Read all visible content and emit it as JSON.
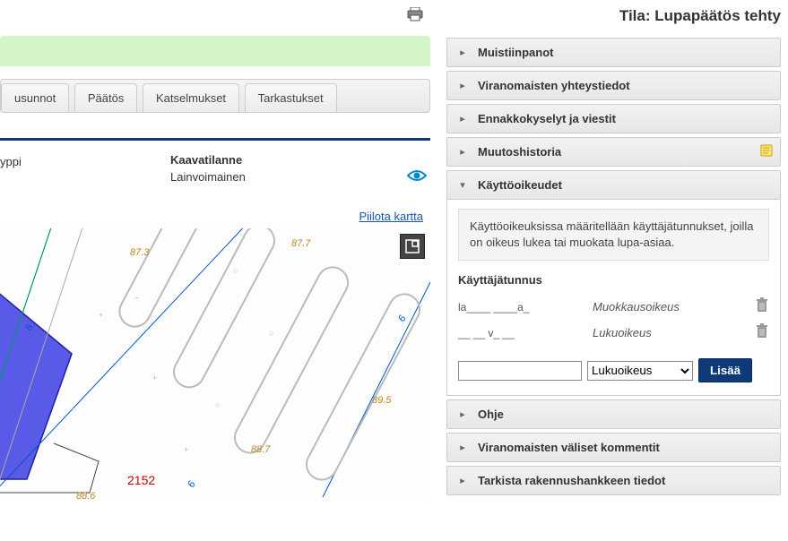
{
  "status": {
    "label": "Tila:",
    "value": "Lupapäätös tehty"
  },
  "tabs": [
    "usunnot",
    "Päätös",
    "Katselmukset",
    "Tarkastukset"
  ],
  "kaava": {
    "yppi": "yppi",
    "title": "Kaavatilanne",
    "value": "Lainvoimainen"
  },
  "hide_map": "Piilota kartta",
  "map_labels": {
    "a": "87.3",
    "b": "87.7",
    "c": "89.5",
    "d": "88.7",
    "e": "2152",
    "f": "88.6",
    "g": "8",
    "h": "6",
    "i": "6"
  },
  "accordion": {
    "muistiinpanot": "Muistiinpanot",
    "viranomaisten_yhteystiedot": "Viranomaisten yhteystiedot",
    "ennakkokyselyt": "Ennakkokyselyt ja viestit",
    "muutoshistoria": "Muutoshistoria",
    "kayttooikeudet": "Käyttöoikeudet",
    "ohje": "Ohje",
    "viranomaisten_kommentit": "Viranomaisten väliset kommentit",
    "tarkista": "Tarkista rakennushankkeen tiedot"
  },
  "kayttooikeudet_body": {
    "info": "Käyttöoikeuksissa määritellään käyttäjätunnukset, joilla on oikeus lukea tai muokata lupa-asiaa.",
    "header": "Käyttäjätunnus",
    "rows": [
      {
        "user": "la____ ____a_",
        "perm": "Muokkausoikeus"
      },
      {
        "user": "__ __ v_ __",
        "perm": "Lukuoikeus"
      }
    ],
    "select_value": "Lukuoikeus",
    "add_button": "Lisää"
  }
}
